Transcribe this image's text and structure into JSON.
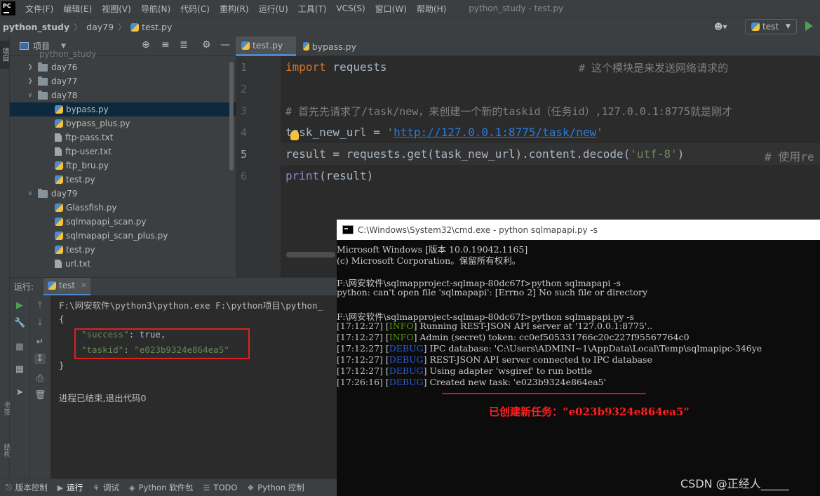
{
  "menubar": {
    "logo": "PC",
    "items": [
      "文件(F)",
      "编辑(E)",
      "视图(V)",
      "导航(N)",
      "代码(C)",
      "重构(R)",
      "运行(U)",
      "工具(T)",
      "VCS(S)",
      "窗口(W)",
      "帮助(H)"
    ],
    "window_title": "python_study - test.py"
  },
  "navbar": {
    "breadcrumbs": [
      "python_study",
      "day79",
      "test.py"
    ],
    "run_config": "test"
  },
  "left_strip": {
    "project_label": "项目",
    "bookmarks_label": "书签",
    "structure_label": "结构"
  },
  "project_panel": {
    "label": "项目",
    "root_partial": "python_study",
    "tree": [
      {
        "label": "day76",
        "type": "folder",
        "expanded": false
      },
      {
        "label": "day77",
        "type": "folder",
        "expanded": false
      },
      {
        "label": "day78",
        "type": "folder",
        "expanded": true
      },
      {
        "label": "bypass.py",
        "type": "py",
        "selected": true
      },
      {
        "label": "bypass_plus.py",
        "type": "py"
      },
      {
        "label": "ftp-pass.txt",
        "type": "txt"
      },
      {
        "label": "ftp-user.txt",
        "type": "txt"
      },
      {
        "label": "ftp_bru.py",
        "type": "py"
      },
      {
        "label": "test.py",
        "type": "py"
      },
      {
        "label": "day79",
        "type": "folder",
        "expanded": true
      },
      {
        "label": "Glassfish.py",
        "type": "py"
      },
      {
        "label": "sqlmapapi_scan.py",
        "type": "py"
      },
      {
        "label": "sqlmapapi_scan_plus.py",
        "type": "py"
      },
      {
        "label": "test.py",
        "type": "py"
      },
      {
        "label": "url.txt",
        "type": "txt"
      }
    ]
  },
  "editor": {
    "tabs": [
      "test.py",
      "bypass.py"
    ],
    "line_numbers": [
      "1",
      "2",
      "3",
      "4",
      "5",
      "6"
    ],
    "code": {
      "l1_kw": "import",
      "l1_mod": " requests",
      "l1_comment": "# 这个模块是来发送网络请求的",
      "l3_comment": "# 首先先请求了/task/new，来创建一个新的taskid（任务id）,127.0.0.1:8775就是刚才",
      "l4_var": "task_new_url = ",
      "l4_q1": "'",
      "l4_url": "http://127.0.0.1:8775/task/new",
      "l4_q2": "'",
      "l5_code": "result = requests.get(task_new_url).content.decode(",
      "l5_str": "'utf-8'",
      "l5_close": ")",
      "l5_comment": "# 使用re",
      "l6_fn": "print",
      "l6_args": "(result)"
    }
  },
  "run_panel": {
    "label": "运行:",
    "tab": "test",
    "command": "F:\\网安软件\\python3\\python.exe F:\\python项目\\python_",
    "open_brace": "{",
    "success_key": "\"success\"",
    "success_val": ": true,",
    "taskid_key": "\"taskid\"",
    "taskid_sep": ": ",
    "taskid_val": "\"e023b9324e864ea5\"",
    "close_brace": "}",
    "finished": "进程已结束,退出代码0"
  },
  "statusbar": {
    "items": [
      "版本控制",
      "运行",
      "调试",
      "Python 软件包",
      "TODO",
      "Python 控制"
    ]
  },
  "cmd": {
    "title": "C:\\Windows\\System32\\cmd.exe - python  sqlmapapi.py -s",
    "header1": "Microsoft Windows [版本 10.0.19042.1165]",
    "header2": "(c) Microsoft Corporation。保留所有权利。",
    "prompt1": "F:\\网安软件\\sqlmapproject-sqlmap-80dc67f>python sqlmapapi -s",
    "error1": "python: can't open file 'sqlmapapi': [Errno 2] No such file or directory",
    "prompt2": "F:\\网安软件\\sqlmapproject-sqlmap-80dc67f>python sqlmapapi.py -s",
    "logs": [
      {
        "time": "[17:12:27]",
        "level": "INFO",
        "msg": "Running REST-JSON API server at '127.0.0.1:8775'.."
      },
      {
        "time": "[17:12:27]",
        "level": "INFO",
        "msg": "Admin (secret) token: cc0ef505331766c20c227f95567764c0"
      },
      {
        "time": "[17:12:27]",
        "level": "DEBUG",
        "msg": "IPC database: 'C:\\Users\\ADMINI~1\\AppData\\Local\\Temp\\sqlmapipc-346ye"
      },
      {
        "time": "[17:12:27]",
        "level": "DEBUG",
        "msg": "REST-JSON API server connected to IPC database"
      },
      {
        "time": "[17:12:27]",
        "level": "DEBUG",
        "msg": "Using adapter 'wsgiref' to run bottle"
      },
      {
        "time": "[17:26:16]",
        "level": "DEBUG",
        "msg": "Created new task: 'e023b9324e864ea5'"
      }
    ],
    "annotation": "已创建新任务：“e023b9324e864ea5”"
  },
  "watermark": "CSDN @正经人_____",
  "colors": {
    "accent": "#4a88c7",
    "highlight_red": "#e02020",
    "run_green": "#4ea24e"
  }
}
